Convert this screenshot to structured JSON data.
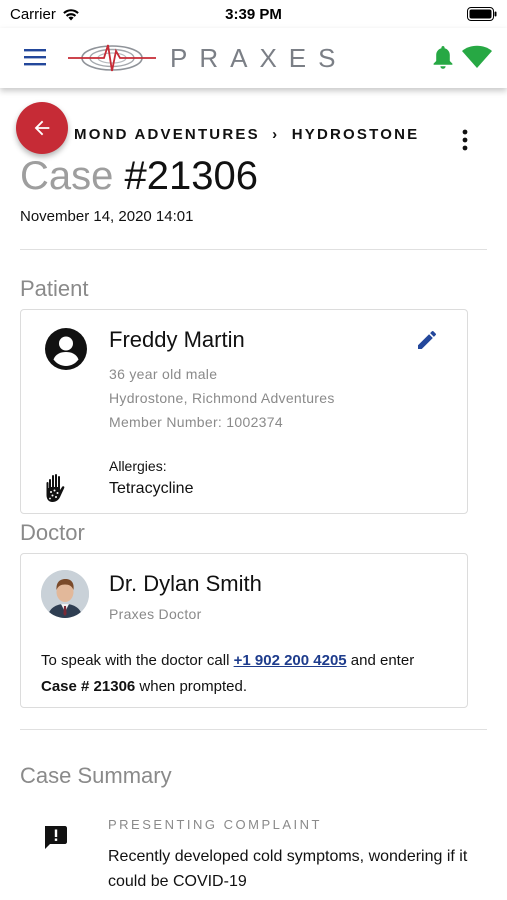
{
  "status_bar": {
    "carrier": "Carrier",
    "time": "3:39 PM"
  },
  "app_bar": {
    "logo_text": "PRAXES"
  },
  "breadcrumb": {
    "visible_text": "MOND ADVENTURES",
    "separator": "›",
    "current": "HYDROSTONE"
  },
  "case": {
    "title_prefix": "Case",
    "number": "#21306",
    "date": "November 14, 2020 14:01"
  },
  "patient": {
    "section_title": "Patient",
    "name": "Freddy Martin",
    "age_sex": "36 year old male",
    "location": "Hydrostone, Richmond Adventures",
    "member_number": "Member Number: 1002374",
    "allergies_label": "Allergies:",
    "allergies_value": "Tetracycline"
  },
  "doctor": {
    "section_title": "Doctor",
    "name": "Dr. Dylan Smith",
    "title": "Praxes Doctor",
    "msg_before": "To speak with the doctor call ",
    "phone": "+1 902 200 4205",
    "msg_middle": " and enter ",
    "case_ref": "Case # 21306",
    "msg_after": " when prompted."
  },
  "summary": {
    "section_title": "Case Summary",
    "complaint_label": "PRESENTING COMPLAINT",
    "complaint_text": "Recently developed cold symptoms, wondering if it could be COVID-19"
  },
  "colors": {
    "accent_red": "#c62b36",
    "link_blue": "#1e3c8c",
    "icon_blue": "#23479b",
    "status_green": "#27a844",
    "muted_gray": "#8a8a8a"
  },
  "icons": [
    "wifi-icon",
    "battery-icon",
    "menu-icon",
    "praxes-logo",
    "notification-bell-icon",
    "signal-icon",
    "back-arrow-icon",
    "more-vert-icon",
    "account-circle-icon",
    "edit-pencil-icon",
    "allergy-hand-icon",
    "feedback-icon"
  ]
}
